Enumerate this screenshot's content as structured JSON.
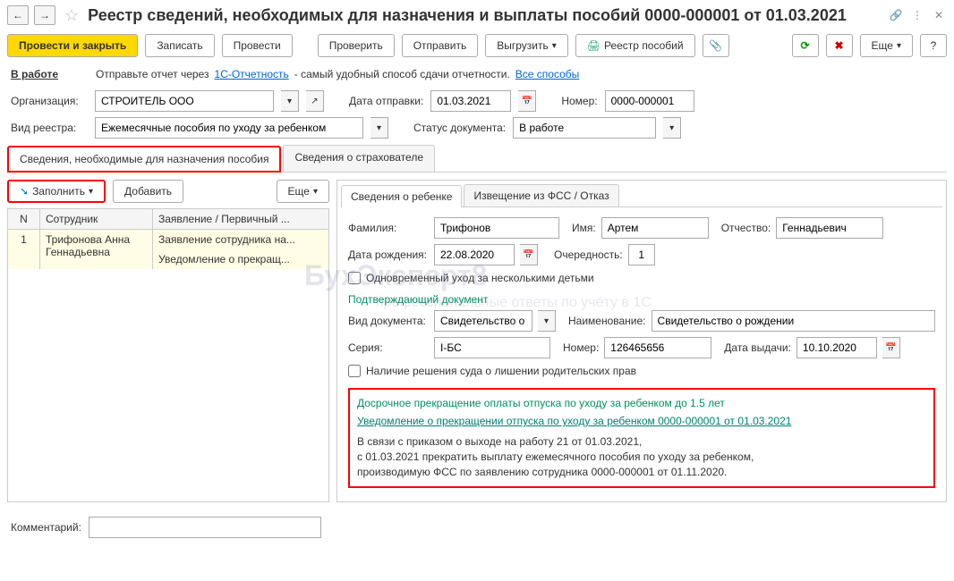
{
  "header": {
    "title": "Реестр сведений, необходимых для назначения и выплаты пособий 0000-000001 от 01.03.2021"
  },
  "toolbar": {
    "post_close": "Провести и закрыть",
    "save": "Записать",
    "post": "Провести",
    "check": "Проверить",
    "send": "Отправить",
    "export": "Выгрузить",
    "registry": "Реестр пособий",
    "more": "Еще"
  },
  "info": {
    "status": "В работе",
    "text1": "Отправьте отчет через",
    "link1": "1С-Отчетность",
    "text2": "- самый удобный способ сдачи отчетности.",
    "link2": "Все способы"
  },
  "form": {
    "org_label": "Организация:",
    "org_value": "СТРОИТЕЛЬ ООО",
    "send_date_label": "Дата отправки:",
    "send_date": "01.03.2021",
    "number_label": "Номер:",
    "number": "0000-000001",
    "registry_type_label": "Вид реестра:",
    "registry_type": "Ежемесячные пособия по уходу за ребенком",
    "doc_status_label": "Статус документа:",
    "doc_status": "В работе"
  },
  "tabs": {
    "tab1": "Сведения, необходимые для назначения пособия",
    "tab2": "Сведения о страхователе"
  },
  "left": {
    "fill": "Заполнить",
    "add": "Добавить",
    "more": "Еще",
    "col_n": "N",
    "col_emp": "Сотрудник",
    "col_doc": "Заявление / Первичный ...",
    "row_n": "1",
    "row_emp": "Трифонова Анна Геннадьевна",
    "row_doc1": "Заявление сотрудника на...",
    "row_doc2": "Уведомление о прекращ..."
  },
  "right": {
    "tab1": "Сведения о ребенке",
    "tab2": "Извещение из ФСС / Отказ",
    "lastname_label": "Фамилия:",
    "lastname": "Трифонов",
    "firstname_label": "Имя:",
    "firstname": "Артем",
    "patronymic_label": "Отчество:",
    "patronymic": "Геннадьевич",
    "birthdate_label": "Дата рождения:",
    "birthdate": "22.08.2020",
    "order_label": "Очередность:",
    "order": "1",
    "simultaneous": "Одновременный уход за несколькими детьми",
    "confirm_doc": "Подтверждающий документ",
    "doc_type_label": "Вид документа:",
    "doc_type": "Свидетельство о р",
    "doc_name_label": "Наименование:",
    "doc_name": "Свидетельство о рождении",
    "series_label": "Серия:",
    "series": "I-БС",
    "docnum_label": "Номер:",
    "docnum": "126465656",
    "issue_date_label": "Дата выдачи:",
    "issue_date": "10.10.2020",
    "court_decision": "Наличие решения суда о лишении родительских прав",
    "early_term_title": "Досрочное прекращение оплаты отпуска по уходу за ребенком до 1.5 лет",
    "early_term_link": "Уведомление о прекращении отпуска по уходу за ребенком 0000-000001 от 01.03.2021",
    "early_term_text": "В связи с приказом о выходе на работу 21 от 01.03.2021,\nс 01.03.2021 прекратить выплату ежемесячного пособия по уходу за ребенком,\nпроизводимую ФСС по заявлению сотрудника 0000-000001 от 01.11.2020."
  },
  "footer": {
    "comment_label": "Комментарий:"
  },
  "watermark": {
    "main": "БухЭксперт8",
    "sub": "профессиональные ответы по учёту в 1С"
  }
}
